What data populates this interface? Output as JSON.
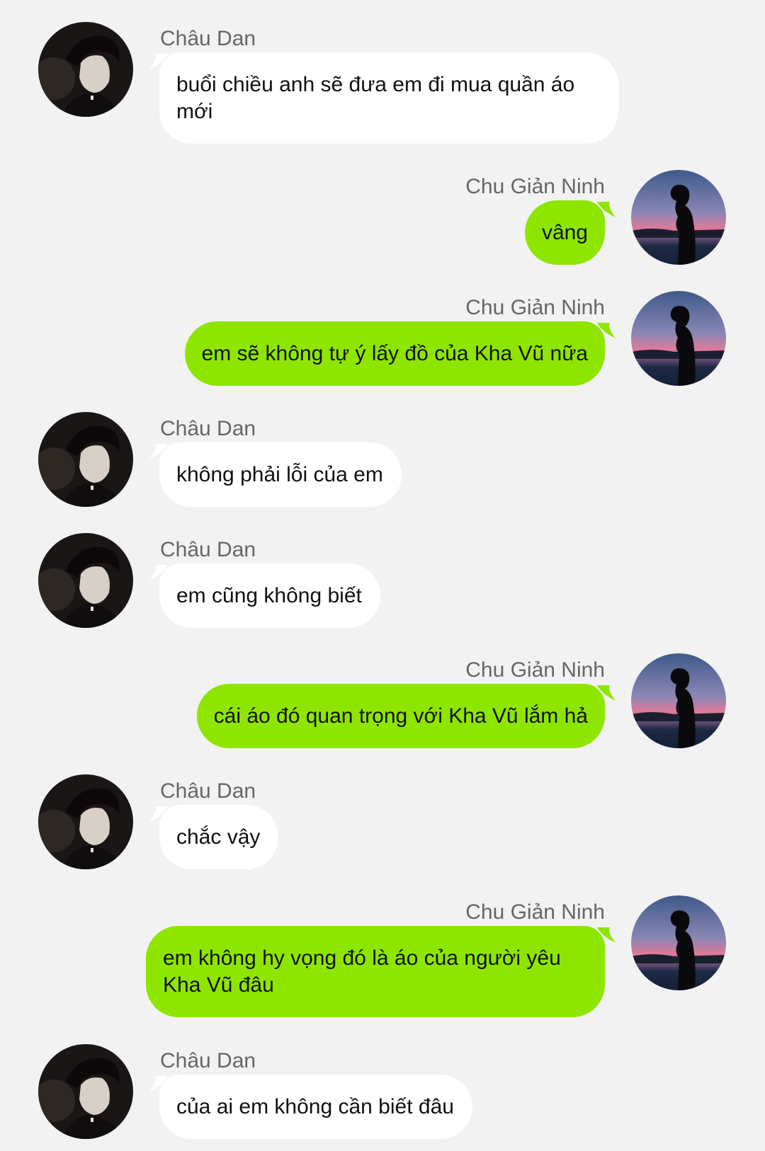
{
  "contacts": {
    "a": {
      "name": "Châu Dan",
      "avatar_icon": "boy-portrait-avatar-icon",
      "bubble_color": "#ffffff"
    },
    "b": {
      "name": "Chu Giản Ninh",
      "avatar_icon": "sunset-silhouette-avatar-icon",
      "bubble_color": "#8ee600"
    }
  },
  "messages": [
    {
      "sender": "Châu Dan",
      "side": "left",
      "text": "buổi chiều anh sẽ đưa em đi mua quần áo mới"
    },
    {
      "sender": "Chu Giản Ninh",
      "side": "right",
      "text": "vâng"
    },
    {
      "sender": "Chu Giản Ninh",
      "side": "right",
      "text": "em sẽ không tự ý lấy đồ của Kha Vũ nữa"
    },
    {
      "sender": "Châu Dan",
      "side": "left",
      "text": "không phải lỗi của em"
    },
    {
      "sender": "Châu Dan",
      "side": "left",
      "text": "em cũng không biết"
    },
    {
      "sender": "Chu Giản Ninh",
      "side": "right",
      "text": "cái áo đó quan trọng với Kha Vũ lắm hả"
    },
    {
      "sender": "Châu Dan",
      "side": "left",
      "text": "chắc vậy"
    },
    {
      "sender": "Chu Giản Ninh",
      "side": "right",
      "text": "em không hy vọng đó là áo của người yêu Kha Vũ đâu"
    },
    {
      "sender": "Châu Dan",
      "side": "left",
      "text": "của ai em không cần biết đâu"
    }
  ]
}
